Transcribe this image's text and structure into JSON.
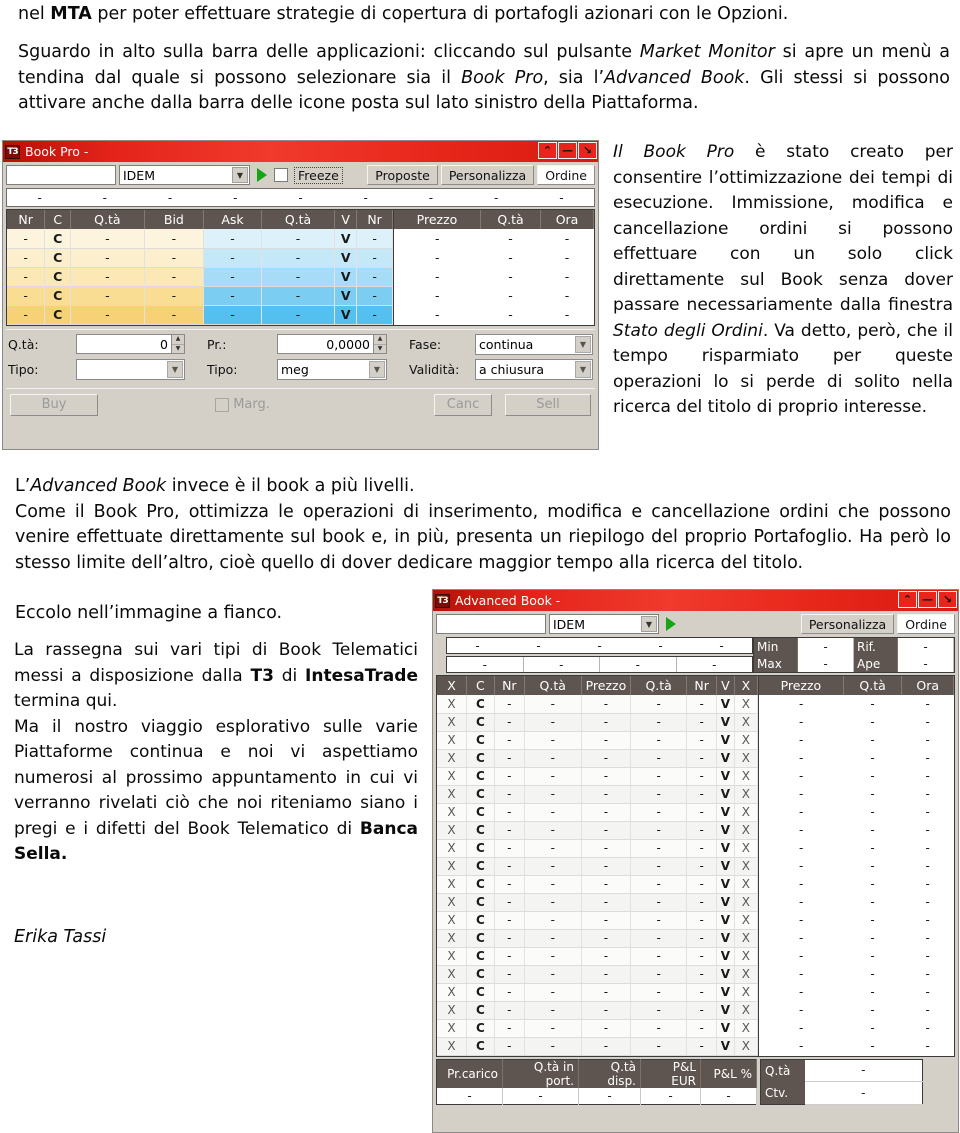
{
  "document": {
    "intro_paragraph": {
      "prefix": "nel ",
      "bold": "MTA",
      "suffix": " per poter effettuare strategie di copertura di portafogli azionari con le Opzioni."
    },
    "second_paragraph": {
      "part1": "Sguardo in alto sulla barra delle applicazioni: cliccando sul pulsante ",
      "italic1": "Market Monitor",
      "part2": " si apre un menù a tendina dal quale si possono selezionare sia il ",
      "italic2": "Book Pro",
      "part3": ", sia l’",
      "italic3": "Advanced Book",
      "part4": ". Gli stessi si possono attivare anche dalla barra delle icone posta sul lato sinistro della Piattaforma."
    },
    "bookpro_description": {
      "italic1": "Il Book Pro",
      "part1": " è stato creato per consentire l’ottimizzazione dei tempi di esecuzione. Immissione, modifica e cancellazione ordini si possono effettuare con un solo click direttamente sul Book senza dover passare necessariamente dalla finestra ",
      "italic2": "Stato degli Ordini",
      "part2": ". Va detto, però, che il tempo risparmiato per queste operazioni lo si perde di solito nella ricerca del titolo di proprio interesse."
    },
    "advbook_paragraph": {
      "part0": "L’",
      "italic1": "Advanced Book",
      "part1": " invece è il book a più livelli.",
      "part2": "Come il Book Pro, ottimizza le operazioni di inserimento, modifica e cancellazione ordini che possono venire effettuate direttamente sul book e, in più, presenta un riepilogo del proprio Portafoglio. Ha però lo stesso limite dell’altro, cioè quello di dover dedicare maggior tempo alla ricerca del titolo."
    },
    "eccolo_paragraph": "Eccolo nell’immagine a fianco.",
    "closing_paragraph": {
      "part1": "La rassegna sui vari tipi di Book Telematici messi a disposizione dalla ",
      "bold1": "T3",
      "part2": " di ",
      "bold2": "IntesaTrade",
      "part3": " termina qui.",
      "part4": "Ma il nostro viaggio esplorativo sulle varie Piattaforme continua e noi vi aspettiamo numerosi al prossimo appuntamento in cui vi verranno rivelati ciò che noi riteniamo siano i pregi e i difetti del Book Telematico di ",
      "bold3": "Banca Sella."
    },
    "signature": "Erika Tassi"
  },
  "book_pro_window": {
    "title": "Book Pro -",
    "logo_text": "T3",
    "window_buttons": [
      "⌃",
      "—",
      "↘"
    ],
    "toolbar": {
      "search_value": "",
      "market_value": "IDEM",
      "play_icon": "play-icon",
      "freeze_checked": false,
      "freeze_label": "Freeze",
      "buttons": [
        "Proposte",
        "Personalizza",
        "Ordine"
      ]
    },
    "quote_bar": [
      "-",
      "-",
      "-",
      "-",
      "-",
      "-",
      "-",
      "-",
      "-"
    ],
    "left_columns": [
      "Nr",
      "C",
      "Q.tà",
      "Bid",
      "Ask",
      "Q.tà",
      "V",
      "Nr"
    ],
    "right_columns": [
      "Prezzo",
      "Q.tà",
      "Ora"
    ],
    "rows": [
      {
        "left": [
          "-",
          "C",
          "-",
          "-",
          "-",
          "-",
          "V",
          "-"
        ],
        "right": [
          "-",
          "-",
          "-"
        ]
      },
      {
        "left": [
          "-",
          "C",
          "-",
          "-",
          "-",
          "-",
          "V",
          "-"
        ],
        "right": [
          "-",
          "-",
          "-"
        ]
      },
      {
        "left": [
          "-",
          "C",
          "-",
          "-",
          "-",
          "-",
          "V",
          "-"
        ],
        "right": [
          "-",
          "-",
          "-"
        ]
      },
      {
        "left": [
          "-",
          "C",
          "-",
          "-",
          "-",
          "-",
          "V",
          "-"
        ],
        "right": [
          "-",
          "-",
          "-"
        ]
      },
      {
        "left": [
          "-",
          "C",
          "-",
          "-",
          "-",
          "-",
          "V",
          "-"
        ],
        "right": [
          "-",
          "-",
          "-"
        ]
      }
    ],
    "form": {
      "qta_label": "Q.tà:",
      "qta_value": "0",
      "tipo1_label": "Tipo:",
      "tipo1_value": "",
      "pr_label": "Pr.:",
      "pr_value": "0,0000",
      "tipo2_label": "Tipo:",
      "tipo2_value": "meg",
      "fase_label": "Fase:",
      "fase_value": "continua",
      "validita_label": "Validità:",
      "validita_value": "a chiusura"
    },
    "actions": {
      "buy": "Buy",
      "marg": "Marg.",
      "canc": "Canc",
      "sell": "Sell"
    },
    "colors": {
      "titlebar": "#e8271b",
      "header": "#5f5550",
      "bid_side": "#f8cf6d",
      "ask_side": "#59c6f0"
    }
  },
  "advanced_book_window": {
    "title": "Advanced Book -",
    "logo_text": "T3",
    "window_buttons": [
      "⌃",
      "—",
      "↘"
    ],
    "toolbar": {
      "search_value": "",
      "market_value": "IDEM",
      "play_icon": "play-icon",
      "buttons": [
        "Personalizza",
        "Ordine"
      ]
    },
    "quote_row_a": [
      "-",
      "-",
      "-",
      "-",
      "-"
    ],
    "quote_row_b": [
      "-",
      "-",
      "-",
      "-"
    ],
    "minmax": [
      {
        "key": "Min",
        "value": "-",
        "key2": "Rif.",
        "value2": "-"
      },
      {
        "key": "Max",
        "value": "-",
        "key2": "Ape",
        "value2": "-"
      }
    ],
    "left_columns": [
      "X",
      "C",
      "Nr",
      "Q.tà",
      "Prezzo",
      "Q.tà",
      "Nr",
      "V",
      "X"
    ],
    "right_columns": [
      "Prezzo",
      "Q.tà",
      "Ora"
    ],
    "row_count": 20,
    "row_template": {
      "left": [
        "X",
        "C",
        "-",
        "-",
        "-",
        "-",
        "-",
        "V",
        "X"
      ],
      "right": [
        "-",
        "-",
        "-"
      ]
    },
    "summary_columns": [
      "Pr.carico",
      "Q.tà in port.",
      "Q.tà disp.",
      "P&L EUR",
      "P&L %"
    ],
    "summary_values": [
      "-",
      "-",
      "-",
      "-",
      "-"
    ],
    "side_summary": [
      {
        "key": "Q.tà",
        "value": "-"
      },
      {
        "key": "Ctv.",
        "value": "-"
      }
    ]
  }
}
